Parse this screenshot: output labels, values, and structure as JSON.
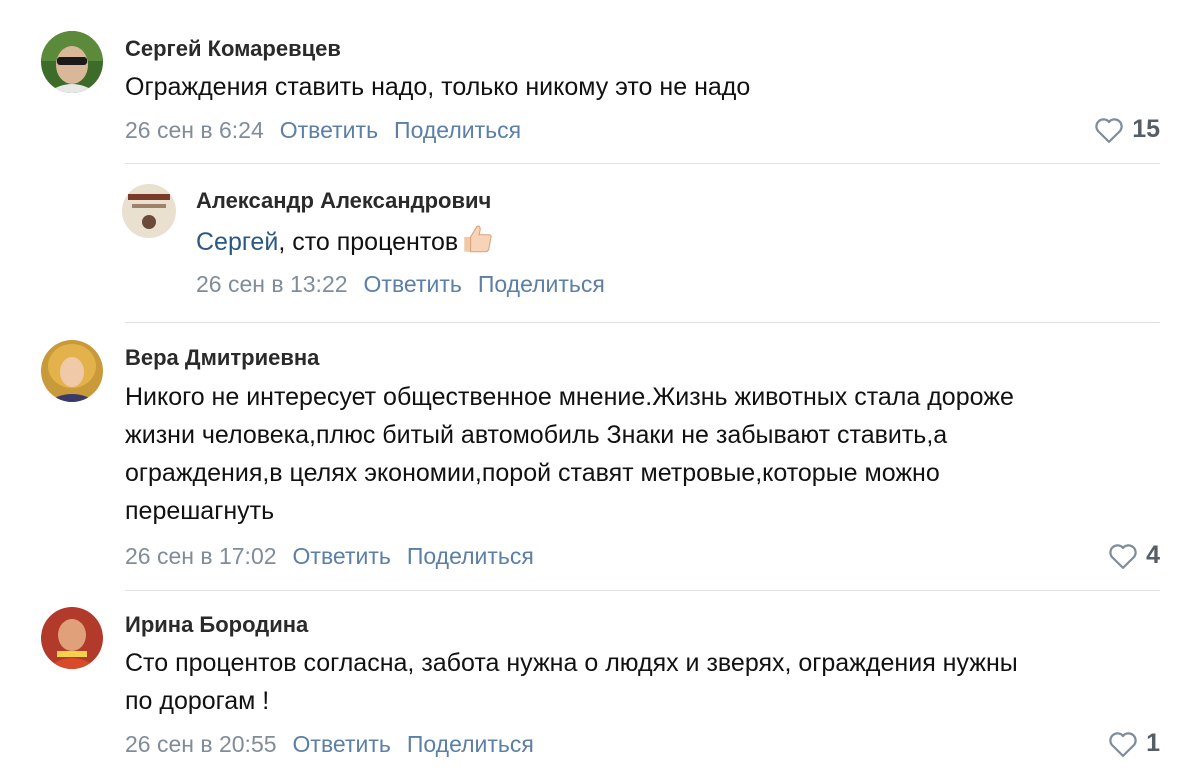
{
  "comments": [
    {
      "author": "Сергей Комаревцев",
      "text": "Ограждения ставить надо, только никому это не надо",
      "date": "26 сен в 6:24",
      "reply_label": "Ответить",
      "share_label": "Поделиться",
      "likes": "15"
    },
    {
      "author": "Александр Александрович",
      "mention": "Сергей",
      "text": ", сто процентов",
      "emoji": "thumbs-up",
      "date": "26 сен в 13:22",
      "reply_label": "Ответить",
      "share_label": "Поделиться"
    },
    {
      "author": "Вера Дмитриевна",
      "text_lines": [
        "Никого не интересует общественное мнение.Жизнь животных стала дороже",
        "жизни человека,плюс битый автомобиль Знаки не забывают ставить,а",
        "ограждения,в целях экономии,порой ставят метровые,которые можно",
        "перешагнуть"
      ],
      "date": "26 сен в 17:02",
      "reply_label": "Ответить",
      "share_label": "Поделиться",
      "likes": "4"
    },
    {
      "author": "Ирина Бородина",
      "text_lines": [
        "Сто процентов согласна, забота нужна о людях и зверях, ограждения нужны",
        "по дорогам !"
      ],
      "date": "26 сен в 20:55",
      "reply_label": "Ответить",
      "share_label": "Поделиться",
      "likes": "1"
    }
  ],
  "icons": {
    "heart": "heart-outline-icon",
    "thumbs_up": "thumbs-up-emoji"
  },
  "colors": {
    "link": "#5b7fa6",
    "date": "#818c99",
    "separator": "#dfe2e7"
  }
}
